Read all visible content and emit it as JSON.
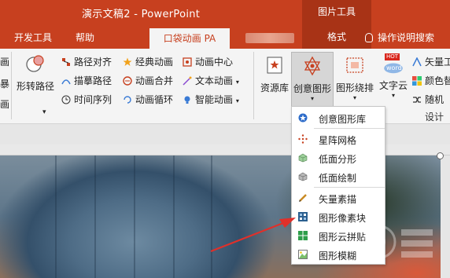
{
  "window": {
    "title": "演示文稿2 - PowerPoint",
    "context_tool": "图片工具"
  },
  "tabs": {
    "developer": "开发工具",
    "help": "帮助",
    "active": "口袋动画 PA",
    "format": "格式",
    "tell_me": "操作说明搜索"
  },
  "ribbon": {
    "left_partial": [
      "画",
      "暴",
      "画"
    ],
    "turn_path": "形转路径",
    "col1": [
      "路径对齐",
      "描摹路径",
      "时间序列"
    ],
    "col2": [
      "经典动画",
      "动画合并",
      "动画循环"
    ],
    "col3": [
      "动画中心",
      "文本动画",
      "智能动画"
    ],
    "resource_lib": "资源库",
    "creative_shape": "创意图形",
    "shape_wrap": "图形绕排",
    "word_cloud": "文字云",
    "right_col": [
      "矢量工",
      "颜色替",
      "随机"
    ],
    "design_group": "设计",
    "hot_badge": "HOT",
    "word_badge": "word"
  },
  "menu": {
    "items": [
      {
        "label": "创意图形库",
        "icon": "star-circle-icon"
      },
      {
        "label": "星阵网格",
        "icon": "star-grid-icon"
      },
      {
        "label": "低面分形",
        "icon": "low-poly-icon"
      },
      {
        "label": "低面绘制",
        "icon": "low-poly-draw-icon"
      },
      {
        "label": "矢量素描",
        "icon": "pencil-icon"
      },
      {
        "label": "图形像素块",
        "icon": "pixel-block-icon"
      },
      {
        "label": "图形云拼贴",
        "icon": "cloud-collage-icon"
      },
      {
        "label": "图形模糊",
        "icon": "blur-image-icon"
      }
    ]
  },
  "colors": {
    "accent": "#c7401f",
    "context": "#a83316",
    "ribbon_bg": "#f4f4f4",
    "arrow": "#e0302a"
  }
}
